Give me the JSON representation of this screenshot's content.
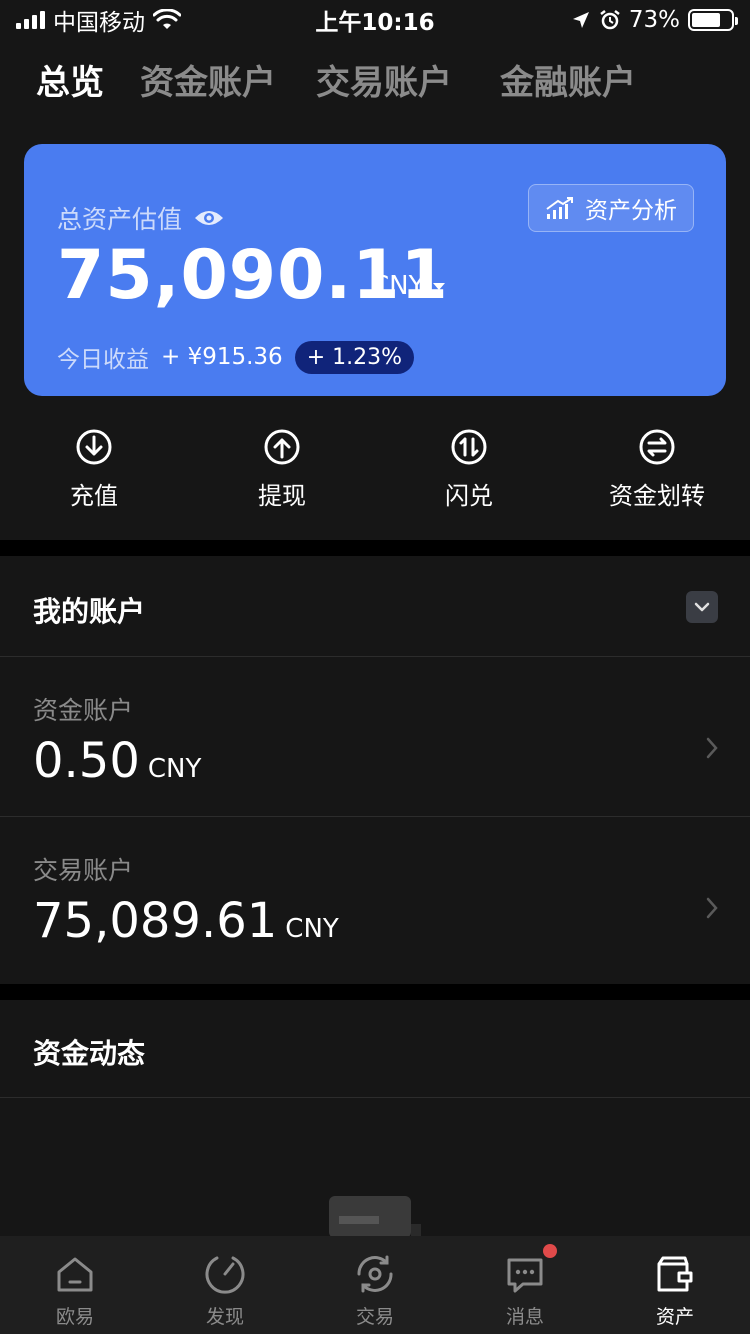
{
  "status_bar": {
    "carrier": "中国移动",
    "time": "上午10:16",
    "battery": "73%",
    "battery_level": 0.73
  },
  "tabs": [
    {
      "label": "总览",
      "active": true
    },
    {
      "label": "资金账户",
      "active": false
    },
    {
      "label": "交易账户",
      "active": false
    },
    {
      "label": "金融账户",
      "active": false
    }
  ],
  "asset_card": {
    "label": "总资产估值",
    "value": "75,090.11",
    "currency": "CNY",
    "analysis_label": "资产分析",
    "today_label": "今日收益",
    "today_amount": "+ ¥915.36",
    "today_percent": "+ 1.23%",
    "color": "#4a7cf0"
  },
  "quick_actions": [
    {
      "label": "充值",
      "icon": "deposit-icon"
    },
    {
      "label": "提现",
      "icon": "withdraw-icon"
    },
    {
      "label": "闪兑",
      "icon": "swap-icon"
    },
    {
      "label": "资金划转",
      "icon": "transfer-icon"
    }
  ],
  "my_accounts": {
    "title": "我的账户",
    "accounts": [
      {
        "label": "资金账户",
        "value": "0.50",
        "unit": "CNY"
      },
      {
        "label": "交易账户",
        "value": "75,089.61",
        "unit": "CNY"
      }
    ]
  },
  "fund_activity": {
    "title": "资金动态"
  },
  "bottom_nav": [
    {
      "label": "欧易",
      "icon": "home-icon",
      "active": false
    },
    {
      "label": "发现",
      "icon": "discover-icon",
      "active": false
    },
    {
      "label": "交易",
      "icon": "trade-icon",
      "active": false
    },
    {
      "label": "消息",
      "icon": "message-icon",
      "active": false,
      "badge": true
    },
    {
      "label": "资产",
      "icon": "wallet-icon",
      "active": true
    }
  ]
}
